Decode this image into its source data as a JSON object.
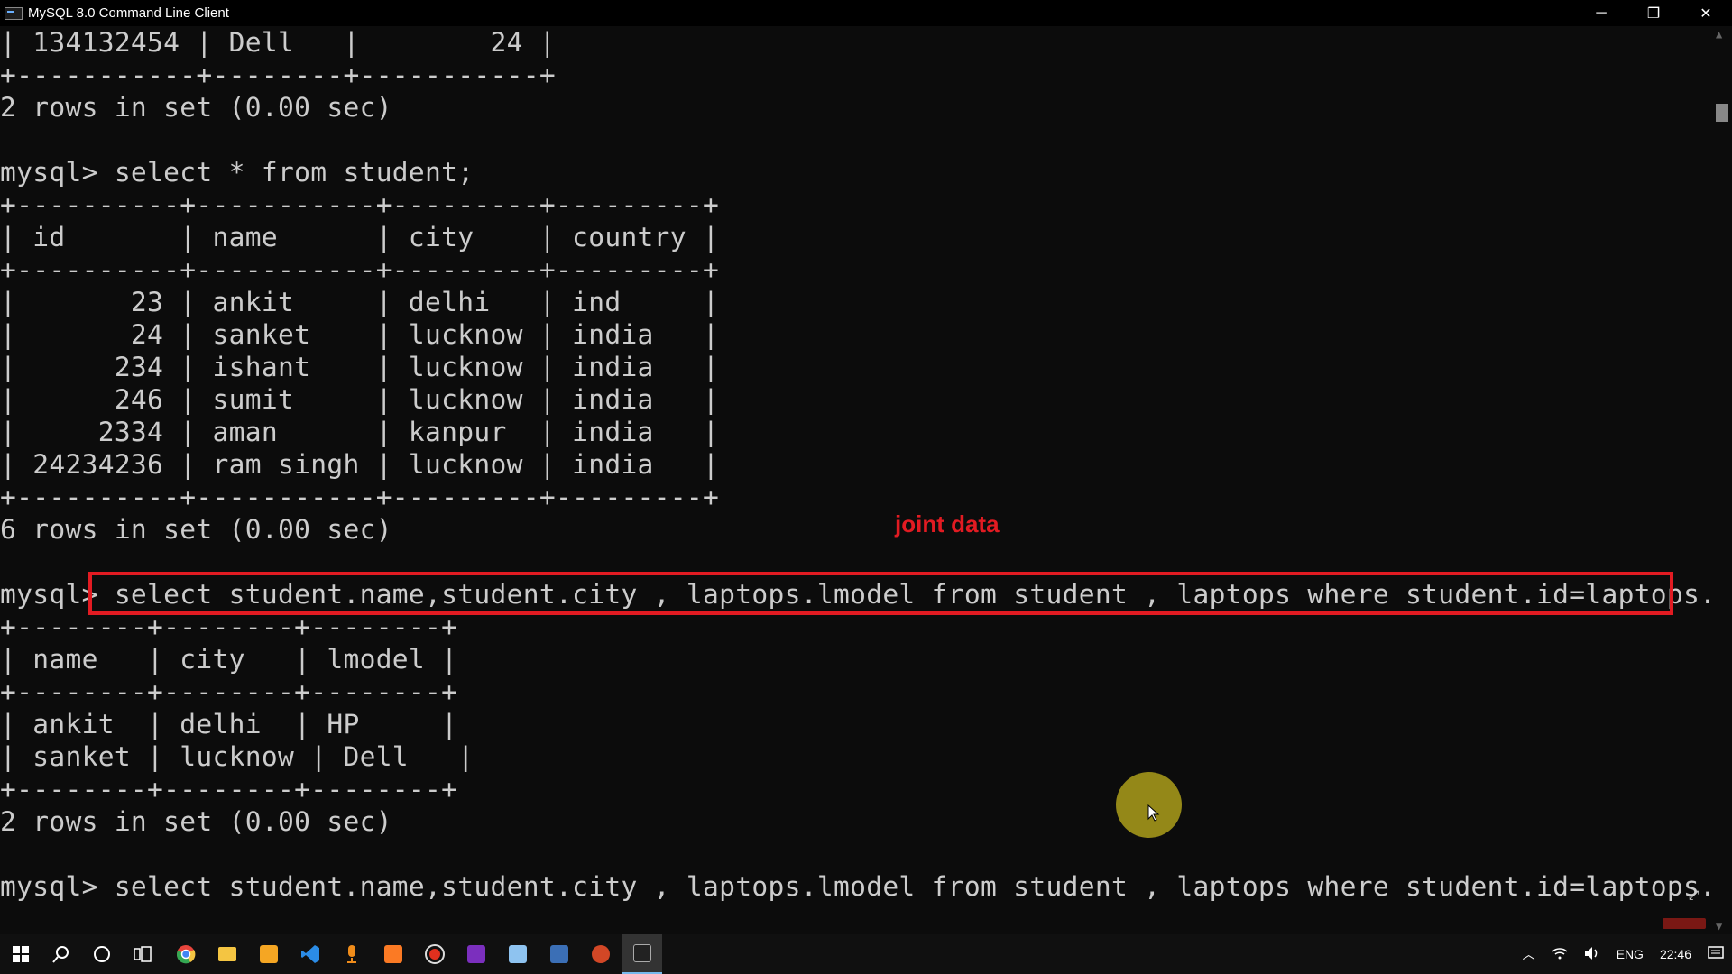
{
  "window": {
    "title": "MySQL 8.0 Command Line Client",
    "minimize": "─",
    "restore": "❐",
    "close": "✕"
  },
  "terminal_lines": [
    "| 134132454 | Dell   |        24 |",
    "+-----------+--------+-----------+",
    "2 rows in set (0.00 sec)",
    "",
    "mysql> select * from student;",
    "+----------+-----------+---------+---------+",
    "| id       | name      | city    | country |",
    "+----------+-----------+---------+---------+",
    "|       23 | ankit     | delhi   | ind     |",
    "|       24 | sanket    | lucknow | india   |",
    "|      234 | ishant    | lucknow | india   |",
    "|      246 | sumit     | lucknow | india   |",
    "|     2334 | aman      | kanpur  | india   |",
    "| 24234236 | ram singh | lucknow | india   |",
    "+----------+-----------+---------+---------+",
    "6 rows in set (0.00 sec)",
    "",
    "mysql> select student.name,student.city , laptops.lmodel from student , laptops where student.id=laptops.studentId;",
    "+--------+--------+--------+",
    "| name   | city   | lmodel |",
    "+--------+--------+--------+",
    "| ankit  | delhi  | HP     |",
    "| sanket | lucknow | Dell   |",
    "+--------+--------+--------+",
    "2 rows in set (0.00 sec)",
    "",
    "mysql> select student.name,student.city , laptops.lmodel from student , laptops where student.id=laptops.studentId an;"
  ],
  "annotation": {
    "label": "joint data",
    "color": "#e21b22"
  },
  "taskbar": {
    "apps": [
      {
        "icon": "windows-start-icon"
      },
      {
        "icon": "search-icon"
      },
      {
        "icon": "cortana-icon"
      },
      {
        "icon": "task-view-icon"
      },
      {
        "icon": "chrome-icon",
        "color": "#e8453c"
      },
      {
        "icon": "file-explorer-icon",
        "color": "#f4c542"
      },
      {
        "icon": "sublime-text-icon",
        "color": "#f5a623"
      },
      {
        "icon": "vscode-icon",
        "color": "#2b8ce6"
      },
      {
        "icon": "microphone-app-icon",
        "color": "#f08c1a"
      },
      {
        "icon": "xampp-icon",
        "color": "#fb7a24"
      },
      {
        "icon": "record-icon",
        "color": "#e0301e"
      },
      {
        "icon": "onenote-icon",
        "color": "#7b2fbe"
      },
      {
        "icon": "editor-icon",
        "color": "#8ec3f0"
      },
      {
        "icon": "mysql-workbench-icon",
        "color": "#3b6fb6"
      },
      {
        "icon": "powerpoint-icon",
        "color": "#d24726"
      },
      {
        "icon": "mysql-cli-icon",
        "color": "#222222"
      }
    ],
    "tray": {
      "language": "ENG",
      "time": "22:46"
    }
  }
}
